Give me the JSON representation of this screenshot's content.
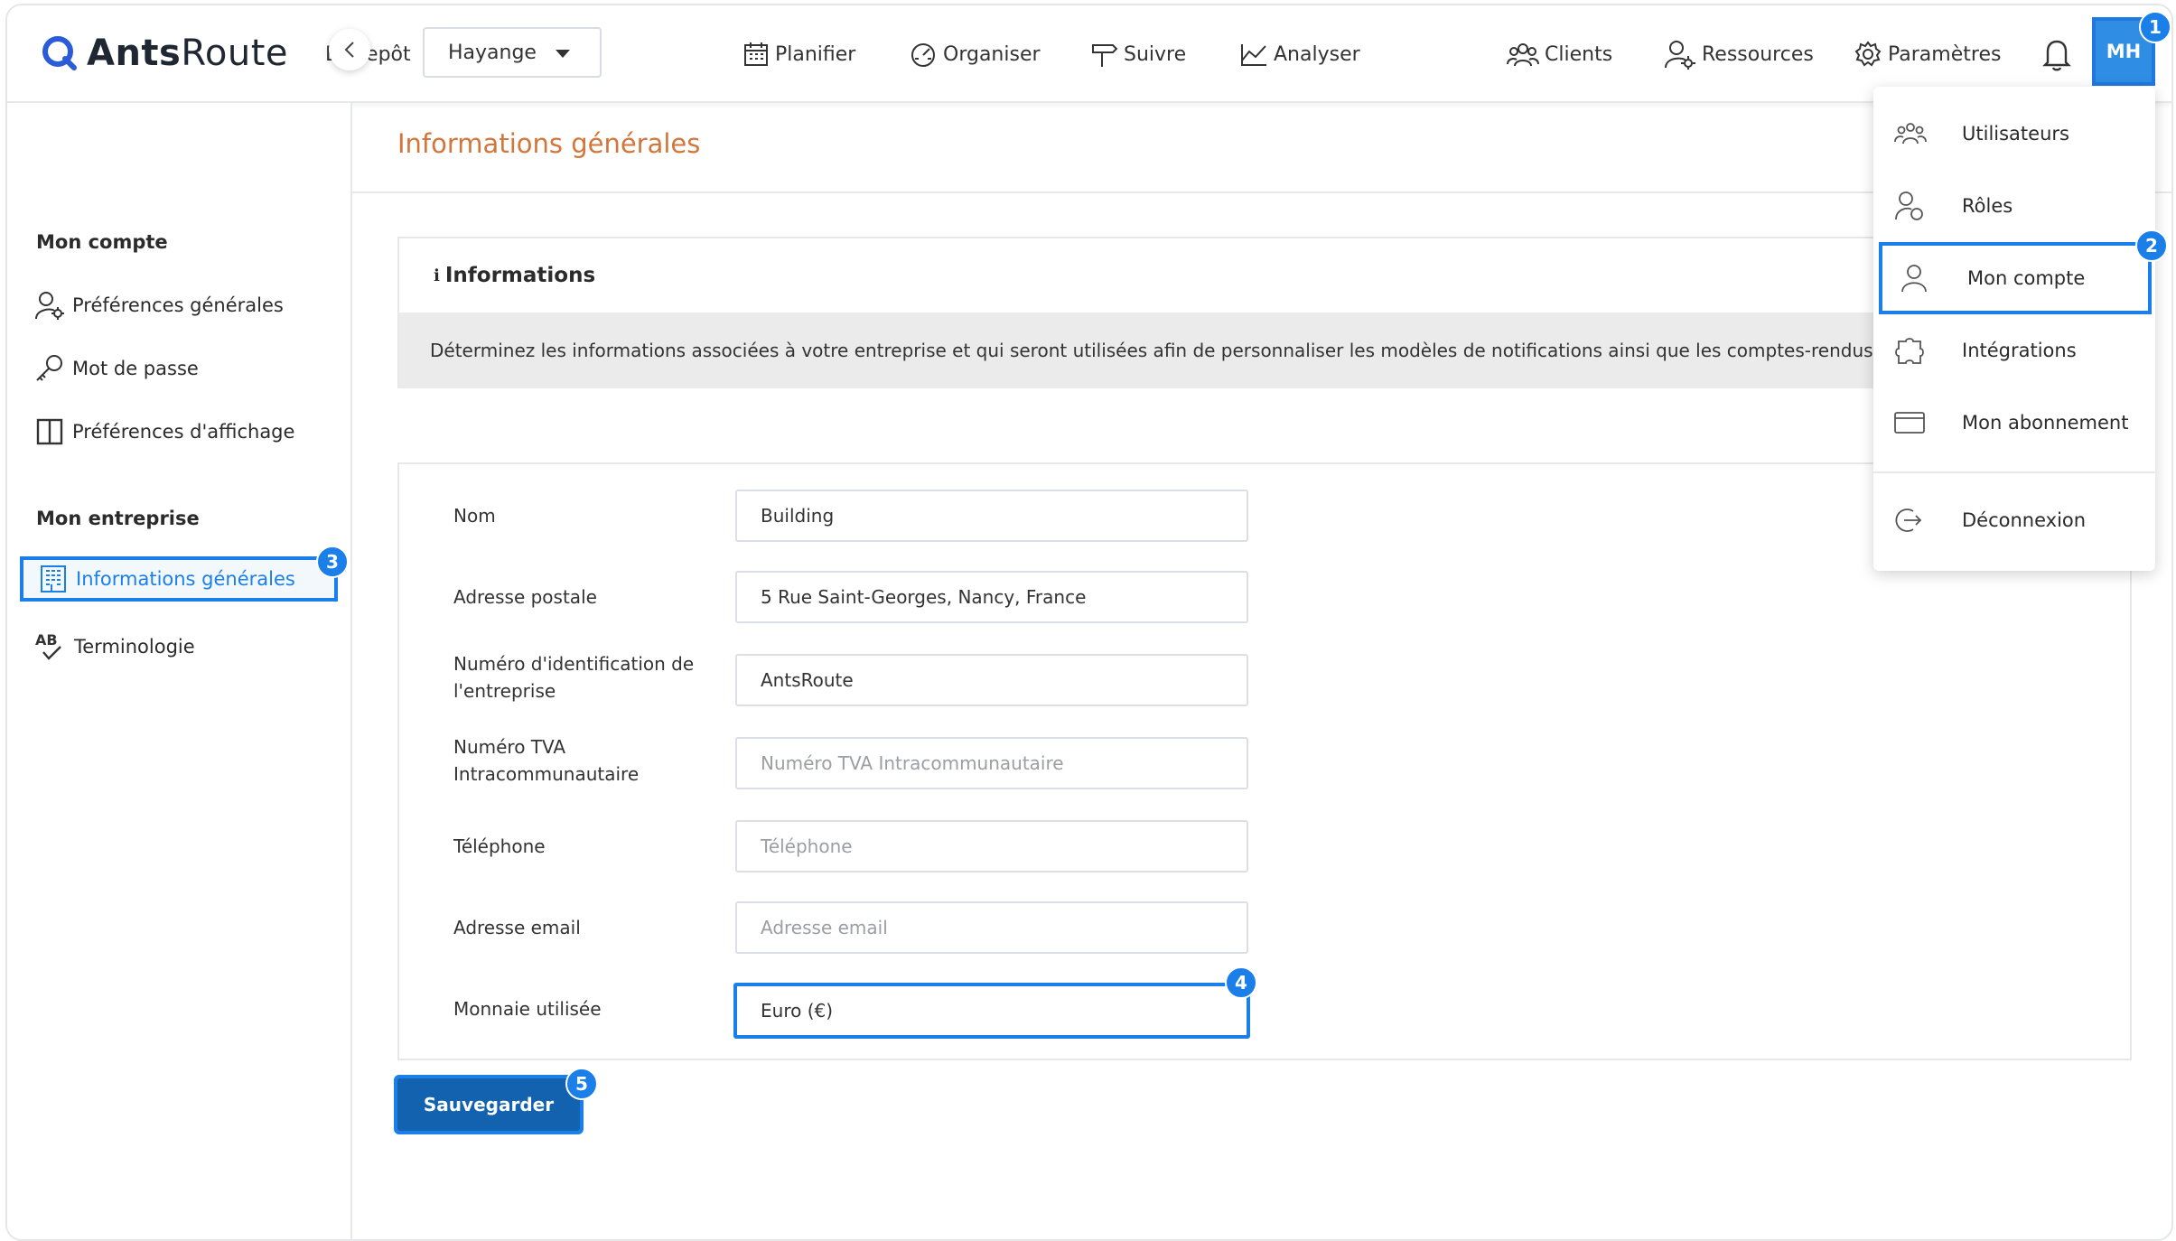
{
  "app": {
    "logo_word_bold": "Ants",
    "logo_word_light": "Route",
    "depot_label": "Entrepôt",
    "depot_value": "Hayange"
  },
  "nav": {
    "planifier": "Planifier",
    "organiser": "Organiser",
    "suivre": "Suivre",
    "analyser": "Analyser",
    "clients": "Clients",
    "ressources": "Ressources",
    "parametres": "Paramètres",
    "avatar_initials": "MH"
  },
  "sidebar": {
    "section_account": "Mon compte",
    "account_items": [
      "Préférences générales",
      "Mot de passe",
      "Préférences d'affichage"
    ],
    "section_company": "Mon entreprise",
    "company_items": [
      "Informations générales",
      "Terminologie"
    ]
  },
  "main": {
    "page_title": "Informations générales",
    "info_card_title": "Informations",
    "info_card_text": "Déterminez les informations associées à votre entreprise et qui seront utilisées afin de personnaliser les modèles de notifications ainsi que les comptes-rendus e"
  },
  "form": {
    "fields": [
      {
        "label": "Nom",
        "value": "Building",
        "placeholder": ""
      },
      {
        "label": "Adresse postale",
        "value": "5 Rue Saint-Georges, Nancy, France",
        "placeholder": ""
      },
      {
        "label": "Numéro d'identification de l'entreprise",
        "value": "AntsRoute",
        "placeholder": ""
      },
      {
        "label": "Numéro TVA Intracommunautaire",
        "value": "",
        "placeholder": "Numéro TVA Intracommunautaire"
      },
      {
        "label": "Téléphone",
        "value": "",
        "placeholder": "Téléphone"
      },
      {
        "label": "Adresse email",
        "value": "",
        "placeholder": "Adresse email"
      },
      {
        "label": "Monnaie utilisée",
        "value": "Euro (€)",
        "placeholder": ""
      }
    ],
    "save_label": "Sauvegarder"
  },
  "menu": {
    "items": [
      "Utilisateurs",
      "Rôles",
      "Mon compte",
      "Intégrations",
      "Mon abonnement",
      "Déconnexion"
    ]
  },
  "steps": [
    "1",
    "2",
    "3",
    "4",
    "5"
  ],
  "colors": {
    "accent": "#1a7fe8",
    "title_orange": "#d2763a",
    "save_button": "#1362b0",
    "avatar": "#2f8de4"
  }
}
